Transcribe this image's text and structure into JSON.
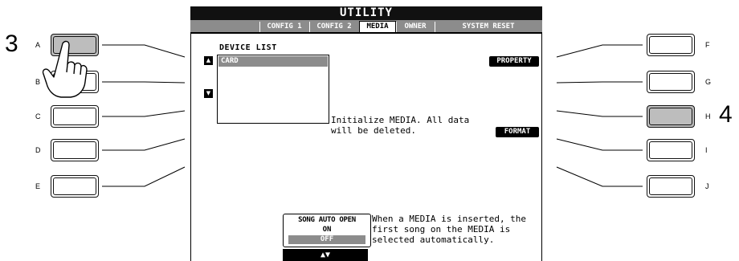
{
  "steps": {
    "left": "3",
    "right": "4"
  },
  "left_buttons": [
    "A",
    "B",
    "C",
    "D",
    "E"
  ],
  "right_buttons": [
    "F",
    "G",
    "H",
    "I",
    "J"
  ],
  "lcd": {
    "title": "UTILITY",
    "tabs": [
      "CONFIG 1",
      "CONFIG 2",
      "MEDIA",
      "OWNER",
      "SYSTEM RESET"
    ],
    "active_tab": "MEDIA",
    "device_list_label": "DEVICE LIST",
    "device_selected": "CARD",
    "property_label": "PROPERTY",
    "format_label": "FORMAT",
    "init_message": "Initialize MEDIA. All data will be deleted.",
    "song_auto_open_label": "SONG AUTO OPEN",
    "song_auto_open_on": "ON",
    "song_auto_open_off": "OFF",
    "auto_open_message": "When a MEDIA is inserted, the first song on the MEDIA is selected automatically.",
    "updown_icon": "▲▼"
  },
  "colors": {
    "highlight": "#8c8c8c",
    "pressed_button": "#bdbdbd"
  },
  "icons": [
    "hand-pointer-icon",
    "up-arrow-icon",
    "down-arrow-icon",
    "up-down-arrow-icon"
  ]
}
